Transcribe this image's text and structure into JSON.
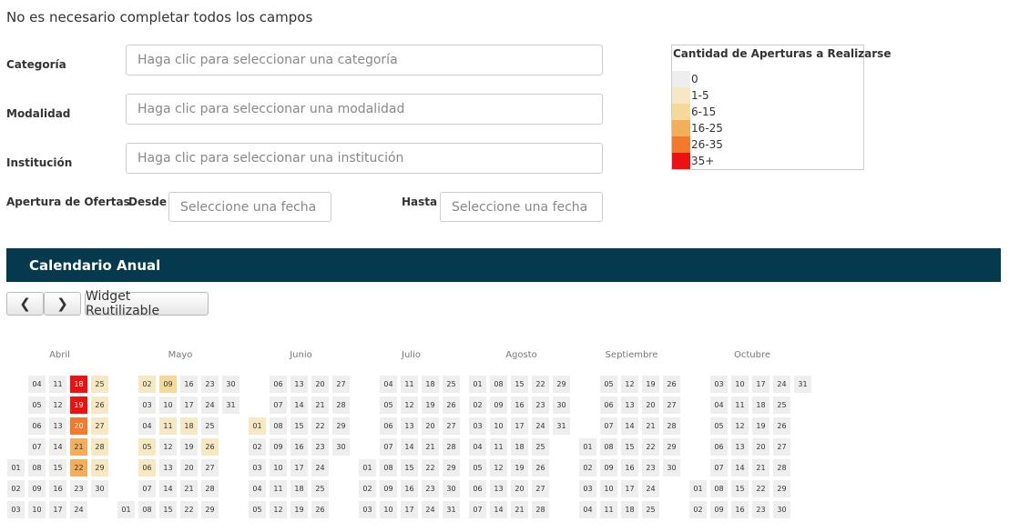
{
  "note": "No es necesario completar todos los campos",
  "filters": {
    "categoria": {
      "label": "Categoría",
      "placeholder": "Haga clic para seleccionar una categoría"
    },
    "modalidad": {
      "label": "Modalidad",
      "placeholder": "Haga clic para seleccionar una modalidad"
    },
    "institucion": {
      "label": "Institución",
      "placeholder": "Haga clic para seleccionar una institución"
    },
    "apertura": {
      "label": "Apertura de Ofertas",
      "desde_label": "Desde",
      "hasta_label": "Hasta",
      "desde_placeholder": "Seleccione una fecha",
      "hasta_placeholder": "Seleccione una fecha"
    }
  },
  "legend": {
    "title": "Cantidad de Aperturas a Realizarse",
    "items": [
      {
        "label": "0",
        "color": "#eeeeee"
      },
      {
        "label": "1-5",
        "color": "#f6e8c3"
      },
      {
        "label": "6-15",
        "color": "#f5d999"
      },
      {
        "label": "16-25",
        "color": "#f2ae58"
      },
      {
        "label": "26-35",
        "color": "#f37a2a"
      },
      {
        "label": "35+",
        "color": "#ee1111"
      }
    ]
  },
  "calendar": {
    "title": "Calendario Anual",
    "prev": "❮",
    "next": "❯",
    "widget": "Widget Reutilizable",
    "months": [
      {
        "name": "Abril",
        "days": 30,
        "startRow": 4,
        "hot": {
          "18": 5,
          "19": 5,
          "20": 4,
          "21": 3,
          "22": 3,
          "25": 1,
          "26": 1,
          "27": 1,
          "28": 1,
          "29": 1
        }
      },
      {
        "name": "Mayo",
        "days": 31,
        "startRow": 6,
        "hot": {
          "2": 1,
          "9": 2,
          "11": 1,
          "18": 1,
          "26": 1,
          "5": 1,
          "6": 1
        }
      },
      {
        "name": "Junio",
        "days": 30,
        "startRow": 2,
        "hot": {
          "1": 1
        }
      },
      {
        "name": "Julio",
        "days": 31,
        "startRow": 4,
        "hot": {}
      },
      {
        "name": "Agosto",
        "days": 31,
        "startRow": 0,
        "hot": {}
      },
      {
        "name": "Septiembre",
        "days": 30,
        "startRow": 3,
        "hot": {}
      },
      {
        "name": "Octubre",
        "days": 31,
        "startRow": 5,
        "hot": {}
      }
    ]
  }
}
